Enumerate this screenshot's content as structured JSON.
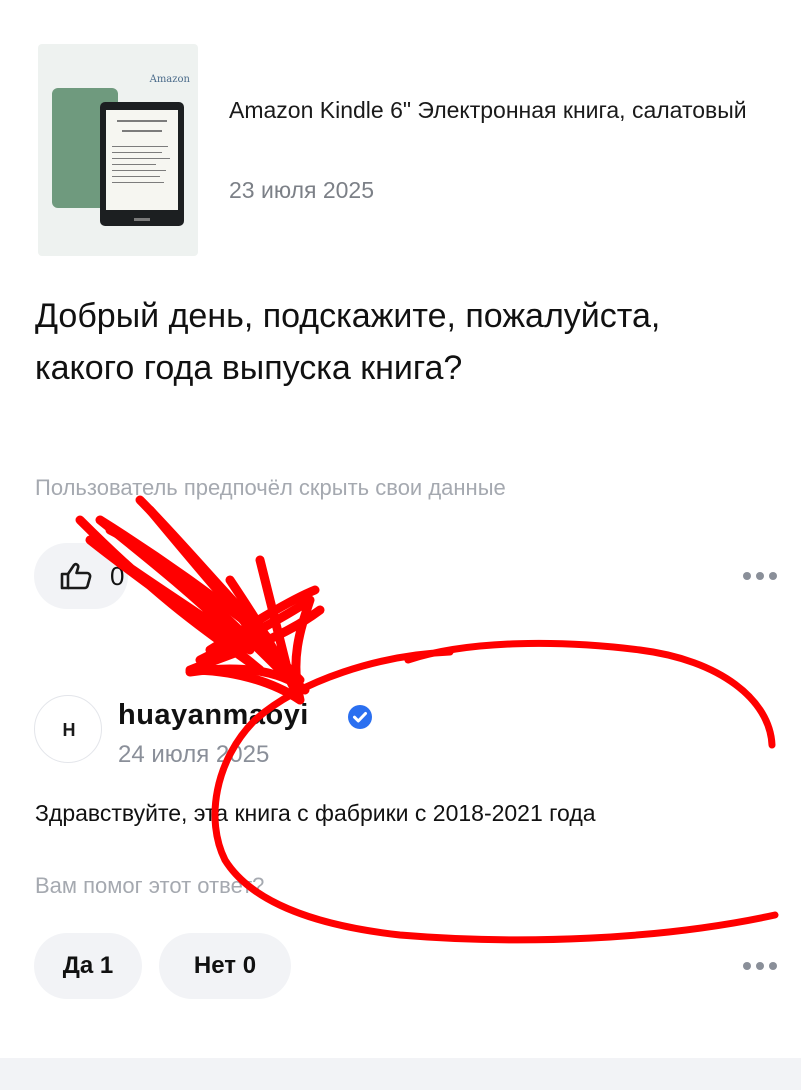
{
  "product": {
    "thumbnail_icon": "kindle-ereader-image",
    "thumbnail_brand": "Amazon",
    "title": "Amazon Kindle 6\" Электронная книга, салатовый",
    "date": "23 июля 2025"
  },
  "question": {
    "text": "Добрый день, подскажите, пожалуйста, какого года выпуска книга?",
    "author_note": "Пользователь предпочёл скрыть свои данные",
    "like_icon": "thumbs-up-icon",
    "like_count": "0"
  },
  "answer": {
    "avatar_letter": "H",
    "author": "huayanmaoyi",
    "verified_icon": "verified-check-icon",
    "date": "24 июля 2025",
    "text": "Здравствуйте, эта книга с фабрики с 2018-2021 года",
    "helpful_question": "Вам помог этот ответ?",
    "yes_label": "Да 1",
    "no_label": "Нет 0"
  },
  "more_icon": "more-dots-icon",
  "colors": {
    "muted_text": "#a5a9b0",
    "date_text": "#8a8f99",
    "pill_background": "#f2f3f6",
    "verified_blue": "#2a6ff0",
    "annotation_red": "#ff0000"
  }
}
